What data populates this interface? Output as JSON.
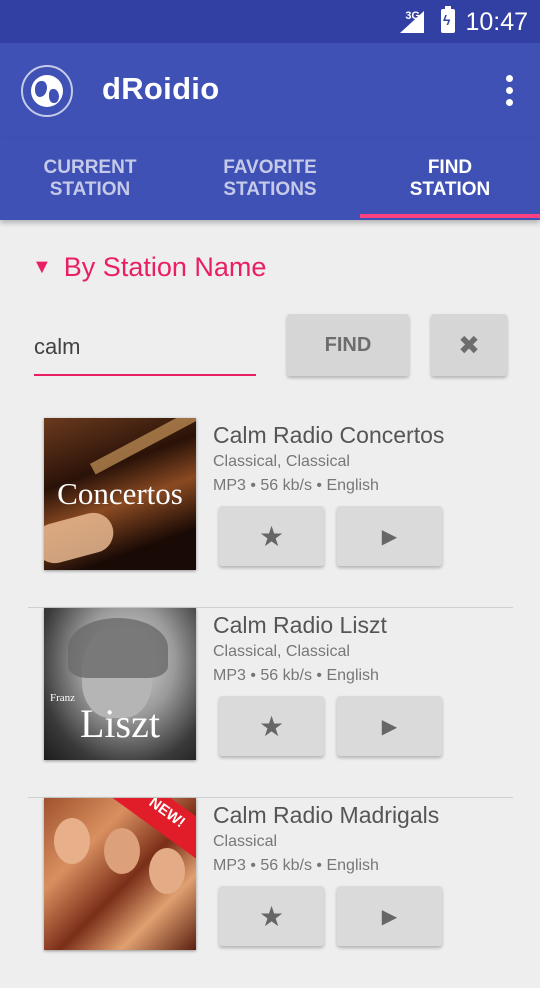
{
  "status_bar": {
    "network": "3G",
    "time": "10:47"
  },
  "app": {
    "title": "dRoidio"
  },
  "tabs": [
    {
      "label": "CURRENT\nSTATION"
    },
    {
      "label": "FAVORITE\nSTATIONS"
    },
    {
      "label": "FIND\nSTATION",
      "active": true
    }
  ],
  "section": {
    "caret": "▼",
    "title": "By Station Name"
  },
  "search": {
    "value": "calm",
    "find_label": "FIND",
    "clear_label": "✖"
  },
  "stations": [
    {
      "name": "Calm Radio Concertos",
      "genre": "Classical, Classical",
      "meta": "MP3 • 56 kb/s • English",
      "art_text": "Concertos",
      "fav": "★",
      "play": "▶"
    },
    {
      "name": "Calm Radio Liszt",
      "genre": "Classical, Classical",
      "meta": "MP3 • 56 kb/s • English",
      "art_small": "Franz",
      "art_text": "Liszt",
      "fav": "★",
      "play": "▶"
    },
    {
      "name": "Calm Radio Madrigals",
      "genre": "Classical",
      "meta": "MP3 • 56 kb/s • English",
      "art_badge": "NEW!",
      "fav": "★",
      "play": "▶"
    }
  ],
  "colors": {
    "primary": "#3f51b5",
    "primary_dark": "#3340a3",
    "accent": "#e91e63"
  }
}
